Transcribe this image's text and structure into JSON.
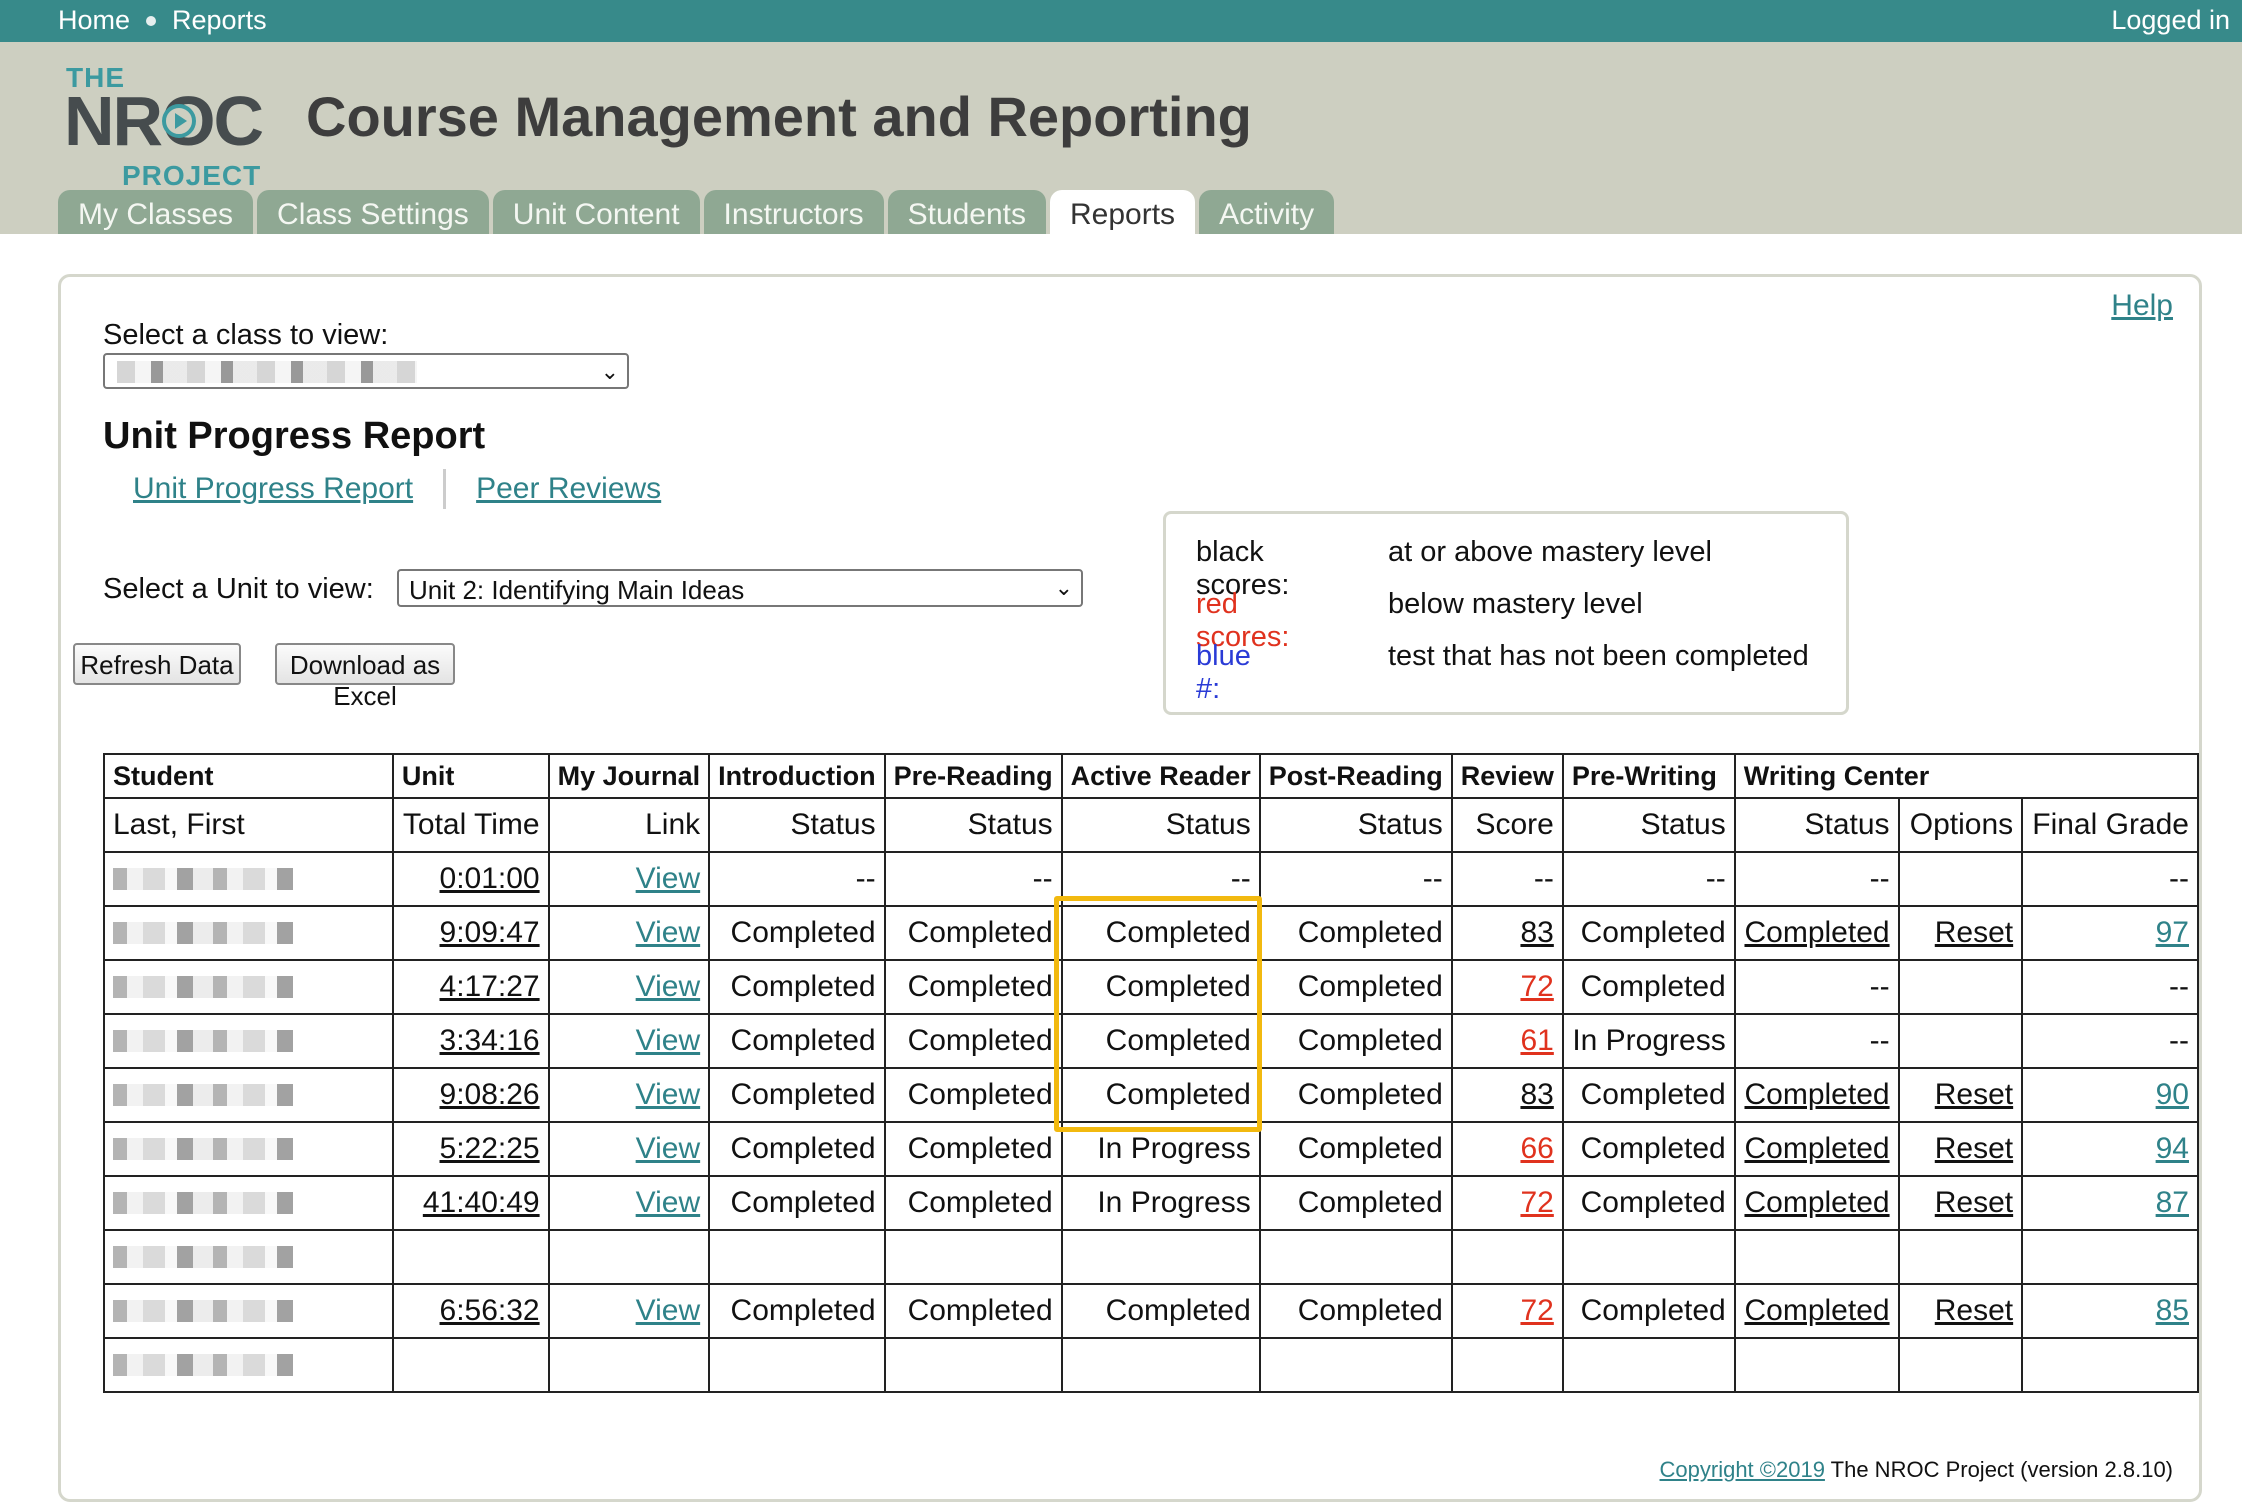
{
  "topbar": {
    "home": "Home",
    "reports": "Reports",
    "logged_in": "Logged in"
  },
  "logo": {
    "the": "THE",
    "nroc": "NROC",
    "project": "PROJECT"
  },
  "header": {
    "title": "Course Management and Reporting"
  },
  "tabs": [
    "My Classes",
    "Class Settings",
    "Unit Content",
    "Instructors",
    "Students",
    "Reports",
    "Activity"
  ],
  "active_tab": "Reports",
  "help": "Help",
  "class_select": {
    "label": "Select a class to view:"
  },
  "report": {
    "title": "Unit Progress Report",
    "links": [
      "Unit Progress Report",
      "Peer Reviews"
    ]
  },
  "unit_select": {
    "label": "Select a Unit to view:",
    "value": "Unit 2: Identifying Main Ideas"
  },
  "buttons": {
    "refresh": "Refresh Data",
    "download": "Download as Excel"
  },
  "legend": [
    {
      "key": "black scores:",
      "value": "at or above mastery level",
      "color": "#111111"
    },
    {
      "key": "red scores:",
      "value": "below mastery level",
      "color": "#e0321e"
    },
    {
      "key": "blue #:",
      "value": "test that has not been completed",
      "color": "#2a3bd6"
    }
  ],
  "table": {
    "header1": [
      "Student",
      "Unit",
      "My Journal",
      "Introduction",
      "Pre-Reading",
      "Active Reader",
      "Post-Reading",
      "Review",
      "Pre-Writing",
      "Writing Center"
    ],
    "header2": [
      "Last, First",
      "Total Time",
      "Link",
      "Status",
      "Status",
      "Status",
      "Status",
      "Score",
      "Status",
      "Status",
      "Options",
      "Final Grade"
    ],
    "rows": [
      {
        "time": "0:01:00",
        "link": "View",
        "intro": "--",
        "pre": "--",
        "active": "--",
        "post": "--",
        "score": "--",
        "score_color": "plain",
        "prewriting": "--",
        "wc": "--",
        "options": "",
        "grade": "--"
      },
      {
        "time": "9:09:47",
        "link": "View",
        "intro": "Completed",
        "pre": "Completed",
        "active": "Completed",
        "post": "Completed",
        "score": "83",
        "score_color": "black",
        "prewriting": "Completed",
        "wc": "Completed",
        "options": "Reset",
        "grade": "97"
      },
      {
        "time": "4:17:27",
        "link": "View",
        "intro": "Completed",
        "pre": "Completed",
        "active": "Completed",
        "post": "Completed",
        "score": "72",
        "score_color": "red",
        "prewriting": "Completed",
        "wc": "--",
        "options": "",
        "grade": "--"
      },
      {
        "time": "3:34:16",
        "link": "View",
        "intro": "Completed",
        "pre": "Completed",
        "active": "Completed",
        "post": "Completed",
        "score": "61",
        "score_color": "red",
        "prewriting": "In Progress",
        "wc": "--",
        "options": "",
        "grade": "--"
      },
      {
        "time": "9:08:26",
        "link": "View",
        "intro": "Completed",
        "pre": "Completed",
        "active": "Completed",
        "post": "Completed",
        "score": "83",
        "score_color": "black",
        "prewriting": "Completed",
        "wc": "Completed",
        "options": "Reset",
        "grade": "90"
      },
      {
        "time": "5:22:25",
        "link": "View",
        "intro": "Completed",
        "pre": "Completed",
        "active": "In Progress",
        "post": "Completed",
        "score": "66",
        "score_color": "red",
        "prewriting": "Completed",
        "wc": "Completed",
        "options": "Reset",
        "grade": "94"
      },
      {
        "time": "41:40:49",
        "link": "View",
        "intro": "Completed",
        "pre": "Completed",
        "active": "In Progress",
        "post": "Completed",
        "score": "72",
        "score_color": "red",
        "prewriting": "Completed",
        "wc": "Completed",
        "options": "Reset",
        "grade": "87"
      },
      {
        "time": "",
        "link": "",
        "intro": "",
        "pre": "",
        "active": "",
        "post": "",
        "score": "",
        "score_color": "plain",
        "prewriting": "",
        "wc": "",
        "options": "",
        "grade": ""
      },
      {
        "time": "6:56:32",
        "link": "View",
        "intro": "Completed",
        "pre": "Completed",
        "active": "Completed",
        "post": "Completed",
        "score": "72",
        "score_color": "red",
        "prewriting": "Completed",
        "wc": "Completed",
        "options": "Reset",
        "grade": "85"
      },
      {
        "time": "",
        "link": "",
        "intro": "",
        "pre": "",
        "active": "",
        "post": "",
        "score": "",
        "score_color": "plain",
        "prewriting": "",
        "wc": "",
        "options": "",
        "grade": ""
      }
    ]
  },
  "footer": {
    "copyright": "Copyright ©2019",
    "rest": "The NROC Project (version 2.8.10)"
  },
  "colors": {
    "teal_bar": "#378a8a",
    "header_bg": "#cdcfc1",
    "tab_bg": "#8fa893",
    "link": "#2f8289",
    "highlight": "#f2b90f"
  }
}
